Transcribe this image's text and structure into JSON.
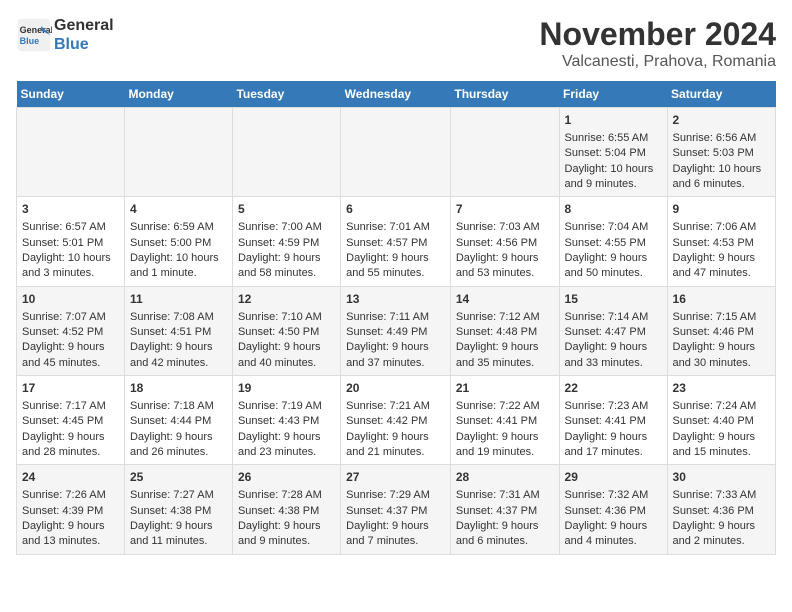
{
  "header": {
    "logo_line1": "General",
    "logo_line2": "Blue",
    "month": "November 2024",
    "location": "Valcanesti, Prahova, Romania"
  },
  "days_of_week": [
    "Sunday",
    "Monday",
    "Tuesday",
    "Wednesday",
    "Thursday",
    "Friday",
    "Saturday"
  ],
  "weeks": [
    [
      {
        "day": "",
        "info": ""
      },
      {
        "day": "",
        "info": ""
      },
      {
        "day": "",
        "info": ""
      },
      {
        "day": "",
        "info": ""
      },
      {
        "day": "",
        "info": ""
      },
      {
        "day": "1",
        "info": "Sunrise: 6:55 AM\nSunset: 5:04 PM\nDaylight: 10 hours and 9 minutes."
      },
      {
        "day": "2",
        "info": "Sunrise: 6:56 AM\nSunset: 5:03 PM\nDaylight: 10 hours and 6 minutes."
      }
    ],
    [
      {
        "day": "3",
        "info": "Sunrise: 6:57 AM\nSunset: 5:01 PM\nDaylight: 10 hours and 3 minutes."
      },
      {
        "day": "4",
        "info": "Sunrise: 6:59 AM\nSunset: 5:00 PM\nDaylight: 10 hours and 1 minute."
      },
      {
        "day": "5",
        "info": "Sunrise: 7:00 AM\nSunset: 4:59 PM\nDaylight: 9 hours and 58 minutes."
      },
      {
        "day": "6",
        "info": "Sunrise: 7:01 AM\nSunset: 4:57 PM\nDaylight: 9 hours and 55 minutes."
      },
      {
        "day": "7",
        "info": "Sunrise: 7:03 AM\nSunset: 4:56 PM\nDaylight: 9 hours and 53 minutes."
      },
      {
        "day": "8",
        "info": "Sunrise: 7:04 AM\nSunset: 4:55 PM\nDaylight: 9 hours and 50 minutes."
      },
      {
        "day": "9",
        "info": "Sunrise: 7:06 AM\nSunset: 4:53 PM\nDaylight: 9 hours and 47 minutes."
      }
    ],
    [
      {
        "day": "10",
        "info": "Sunrise: 7:07 AM\nSunset: 4:52 PM\nDaylight: 9 hours and 45 minutes."
      },
      {
        "day": "11",
        "info": "Sunrise: 7:08 AM\nSunset: 4:51 PM\nDaylight: 9 hours and 42 minutes."
      },
      {
        "day": "12",
        "info": "Sunrise: 7:10 AM\nSunset: 4:50 PM\nDaylight: 9 hours and 40 minutes."
      },
      {
        "day": "13",
        "info": "Sunrise: 7:11 AM\nSunset: 4:49 PM\nDaylight: 9 hours and 37 minutes."
      },
      {
        "day": "14",
        "info": "Sunrise: 7:12 AM\nSunset: 4:48 PM\nDaylight: 9 hours and 35 minutes."
      },
      {
        "day": "15",
        "info": "Sunrise: 7:14 AM\nSunset: 4:47 PM\nDaylight: 9 hours and 33 minutes."
      },
      {
        "day": "16",
        "info": "Sunrise: 7:15 AM\nSunset: 4:46 PM\nDaylight: 9 hours and 30 minutes."
      }
    ],
    [
      {
        "day": "17",
        "info": "Sunrise: 7:17 AM\nSunset: 4:45 PM\nDaylight: 9 hours and 28 minutes."
      },
      {
        "day": "18",
        "info": "Sunrise: 7:18 AM\nSunset: 4:44 PM\nDaylight: 9 hours and 26 minutes."
      },
      {
        "day": "19",
        "info": "Sunrise: 7:19 AM\nSunset: 4:43 PM\nDaylight: 9 hours and 23 minutes."
      },
      {
        "day": "20",
        "info": "Sunrise: 7:21 AM\nSunset: 4:42 PM\nDaylight: 9 hours and 21 minutes."
      },
      {
        "day": "21",
        "info": "Sunrise: 7:22 AM\nSunset: 4:41 PM\nDaylight: 9 hours and 19 minutes."
      },
      {
        "day": "22",
        "info": "Sunrise: 7:23 AM\nSunset: 4:41 PM\nDaylight: 9 hours and 17 minutes."
      },
      {
        "day": "23",
        "info": "Sunrise: 7:24 AM\nSunset: 4:40 PM\nDaylight: 9 hours and 15 minutes."
      }
    ],
    [
      {
        "day": "24",
        "info": "Sunrise: 7:26 AM\nSunset: 4:39 PM\nDaylight: 9 hours and 13 minutes."
      },
      {
        "day": "25",
        "info": "Sunrise: 7:27 AM\nSunset: 4:38 PM\nDaylight: 9 hours and 11 minutes."
      },
      {
        "day": "26",
        "info": "Sunrise: 7:28 AM\nSunset: 4:38 PM\nDaylight: 9 hours and 9 minutes."
      },
      {
        "day": "27",
        "info": "Sunrise: 7:29 AM\nSunset: 4:37 PM\nDaylight: 9 hours and 7 minutes."
      },
      {
        "day": "28",
        "info": "Sunrise: 7:31 AM\nSunset: 4:37 PM\nDaylight: 9 hours and 6 minutes."
      },
      {
        "day": "29",
        "info": "Sunrise: 7:32 AM\nSunset: 4:36 PM\nDaylight: 9 hours and 4 minutes."
      },
      {
        "day": "30",
        "info": "Sunrise: 7:33 AM\nSunset: 4:36 PM\nDaylight: 9 hours and 2 minutes."
      }
    ]
  ]
}
